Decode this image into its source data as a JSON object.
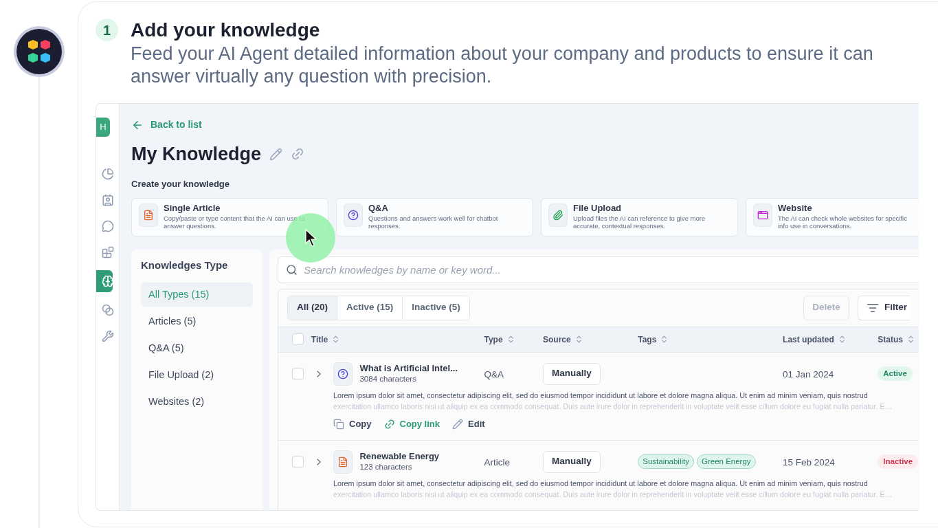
{
  "step": {
    "number": "1",
    "title": "Add your knowledge",
    "subtitle": "Feed your AI Agent detailed information about your company and products to ensure it can answer virtually any question with precision."
  },
  "app": {
    "rail": {
      "avatar": "H",
      "items": [
        {
          "selected": false
        },
        {
          "selected": false
        },
        {
          "selected": false
        },
        {
          "selected": false
        },
        {
          "selected": true
        },
        {
          "selected": false
        },
        {
          "selected": false
        }
      ]
    },
    "back_link": "Back to list",
    "title": "My Knowledge",
    "create_heading": "Create your knowledge",
    "create_cards": [
      {
        "kind": "article",
        "title": "Single Article",
        "description": "Copy/paste or type content that the AI can use to answer questions."
      },
      {
        "kind": "qa",
        "title": "Q&A",
        "description": "Questions and answers work well for chatbot responses."
      },
      {
        "kind": "file",
        "title": "File Upload",
        "description": "Upload files the AI can reference to give more accurate, contextual responses."
      },
      {
        "kind": "website",
        "title": "Website",
        "description": "The AI can check whole websites for specific info use in conversations."
      }
    ],
    "types_panel": {
      "heading": "Knowledges Type",
      "items": [
        {
          "label": "All Types (15)",
          "selected": true
        },
        {
          "label": "Articles (5)",
          "selected": false
        },
        {
          "label": "Q&A (5)",
          "selected": false
        },
        {
          "label": "File Upload (2)",
          "selected": false
        },
        {
          "label": "Websites (2)",
          "selected": false
        }
      ]
    },
    "search": {
      "placeholder": "Search knowledges by name or key word..."
    },
    "filter_tabs": [
      {
        "label": "All (20)",
        "selected": true
      },
      {
        "label": "Active (15)",
        "selected": false
      },
      {
        "label": "Inactive (5)",
        "selected": false
      }
    ],
    "delete_button": {
      "label": "Delete",
      "disabled": true
    },
    "filter_button": "Filter",
    "table": {
      "select_all_checked": false,
      "columns": [
        "Title",
        "Type",
        "Source",
        "Tags",
        "Last updated",
        "Status"
      ],
      "rows": [
        {
          "kind": "qa",
          "checked": false,
          "title": "What is Artificial Intel...",
          "chars": "3084 characters",
          "type": "Q&A",
          "source": "Manually",
          "tags": [],
          "date": "01 Jan 2024",
          "status": {
            "label": "Active",
            "active": true
          },
          "description": "Lorem ipsum dolor sit amet, consectetur adipiscing elit, sed do eiusmod tempor incididunt ut labore et dolore magna aliqua. Ut enim ad minim veniam, quis nostrud",
          "description_more": "exercitation ullamco laboris nisi ut aliquip ex ea commodo consequat. Duis aute irure dolor in reprehenderit in voluptate velit esse cillum dolore eu fugiat nulla pariatur. E…",
          "actions": [
            "Copy",
            "Copy link",
            "Edit"
          ]
        },
        {
          "kind": "article",
          "checked": false,
          "title": "Renewable Energy",
          "chars": "123 characters",
          "type": "Article",
          "source": "Manually",
          "tags": [
            "Sustainability",
            "Green Energy"
          ],
          "date": "15 Feb 2024",
          "status": {
            "label": "Inactive",
            "active": false
          },
          "description": "Lorem ipsum dolor sit amet, consectetur adipiscing elit, sed do eiusmod tempor incididunt ut labore et dolore magna aliqua. Ut enim ad minim veniam, quis nostrud",
          "description_more": "exercitation ullamco laboris nisi ut aliquip ex ea commodo consequat. Duis aute irure dolor in reprehenderit in voluptate velit esse cillum dolore eu fugiat nulla pariatur. E…"
        }
      ]
    }
  }
}
